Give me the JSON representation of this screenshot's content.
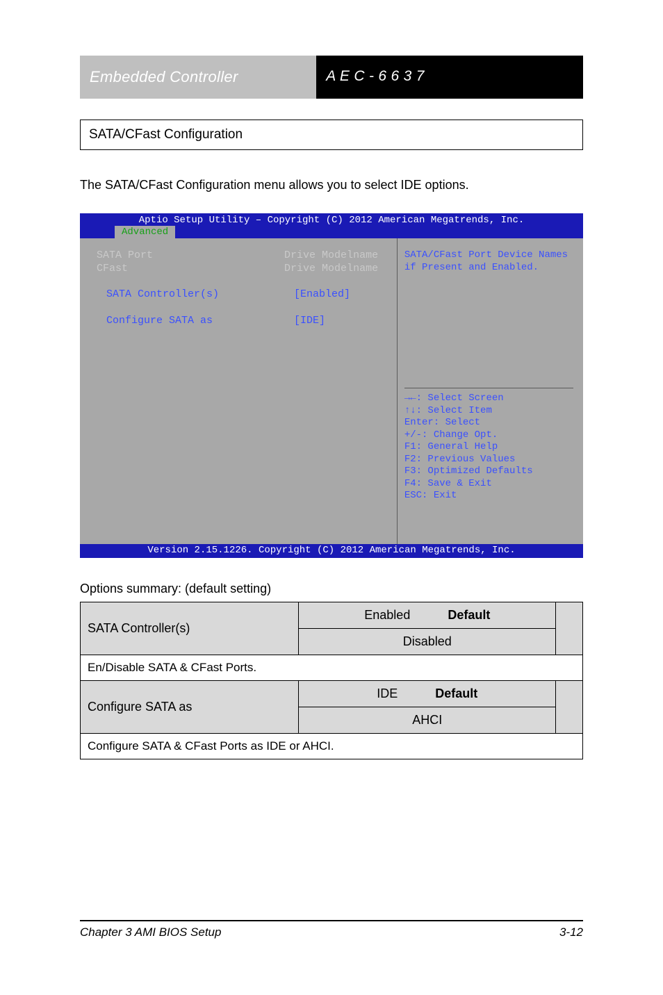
{
  "header": {
    "left_title": "Embedded Controller",
    "right_title": "A E C - 6 6 3 7"
  },
  "section_box": "SATA/CFast Configuration",
  "intro_line": "The SATA/CFast Configuration menu allows you to select IDE options.",
  "bios": {
    "top_title": "Aptio Setup Utility – Copyright (C) 2012 American Megatrends, Inc.",
    "tab": "Advanced",
    "rows": [
      {
        "label": "SATA Port",
        "value": "Drive Modelname",
        "style": "grey"
      },
      {
        "label": "CFast",
        "value": "Drive Modelname",
        "style": "grey"
      },
      {
        "label": "",
        "value": "",
        "style": ""
      },
      {
        "label": "SATA Controller(s)",
        "value": "[Enabled]",
        "style": "sel",
        "indent": true
      },
      {
        "label": "",
        "value": "",
        "style": ""
      },
      {
        "label": "Configure SATA as",
        "value": "[IDE]",
        "style": "sel",
        "indent": true
      }
    ],
    "help_top": "SATA/CFast Port Device Names if Present and Enabled.",
    "help_keys": [
      "→←: Select Screen",
      "↑↓: Select Item",
      "Enter: Select",
      "+/-: Change Opt.",
      "F1: General Help",
      "F2: Previous Values",
      "F3: Optimized Defaults",
      "F4: Save & Exit",
      "ESC: Exit"
    ],
    "footer": "Version 2.15.1226. Copyright (C) 2012 American Megatrends, Inc."
  },
  "options_label": "Options summary: (default setting)",
  "settings_table": {
    "rows": [
      {
        "name": "SATA Controller(s)",
        "opts": [
          "Enabled          Default",
          "Disabled"
        ],
        "desc": "En/Disable SATA & CFast Ports."
      },
      {
        "name": "Configure SATA as",
        "opts": [
          "IDE              Default",
          "AHCI"
        ],
        "desc": "Configure SATA & CFast Ports as IDE or AHCI."
      }
    ]
  },
  "footer": {
    "left": "Chapter 3 AMI BIOS Setup",
    "right": "3-12"
  }
}
